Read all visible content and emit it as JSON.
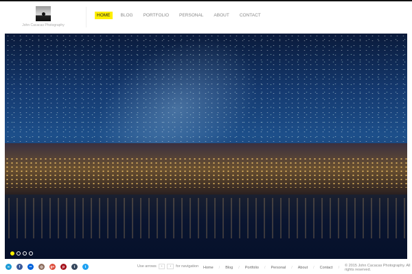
{
  "site": {
    "logo_text": "John Cacacas Photography"
  },
  "nav": [
    {
      "label": "HOME",
      "active": true
    },
    {
      "label": "BLOG"
    },
    {
      "label": "PORTFOLIO"
    },
    {
      "label": "PERSONAL"
    },
    {
      "label": "ABOUT"
    },
    {
      "label": "CONTACT"
    }
  ],
  "slider": {
    "slide_count": 4,
    "current_slide": 1
  },
  "social": [
    {
      "icon": "flickr-alt-icon",
      "glyph": "∞",
      "color": "#1a9ad6"
    },
    {
      "icon": "facebook-icon",
      "glyph": "f",
      "color": "#3b5998"
    },
    {
      "icon": "flickr-icon",
      "glyph": "••",
      "color": "#0063dc"
    },
    {
      "icon": "instagram-icon",
      "glyph": "◎",
      "color": "#8a6a5a"
    },
    {
      "icon": "google-plus-icon",
      "glyph": "g+",
      "color": "#dd4b39"
    },
    {
      "icon": "pinterest-icon",
      "glyph": "p",
      "color": "#a4121c"
    },
    {
      "icon": "tumblr-icon",
      "glyph": "t",
      "color": "#35465c"
    },
    {
      "icon": "twitter-icon",
      "glyph": "t",
      "color": "#1da1f2"
    }
  ],
  "footer": {
    "hint_prefix": "Use arrows",
    "key_left": "‹",
    "key_right": "›",
    "hint_suffix": "for navigation",
    "links": [
      "Home",
      "Blog",
      "Portfolio",
      "Personal",
      "About",
      "Contact"
    ],
    "copyright": "© 2015 John Cacacas Photography. All rights reserved."
  }
}
